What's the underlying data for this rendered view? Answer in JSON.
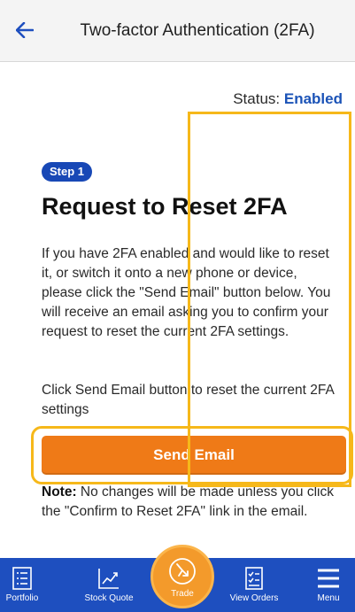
{
  "header": {
    "back_icon": "arrow-left-icon",
    "title": "Two-factor Authentication (2FA)"
  },
  "status": {
    "label": "Status:",
    "value": "Enabled"
  },
  "step": {
    "badge": "Step 1",
    "heading": "Request to Reset 2FA",
    "paragraph1": "If you have 2FA enabled and would like to reset it, or switch it onto a new phone or device, please click the \"Send Email\" button below. You will receive an email asking you to confirm your request to reset the current 2FA settings.",
    "paragraph2": "Click Send Email button to reset the current 2FA settings",
    "send_button": "Send Email",
    "note_label": "Note:",
    "note_text": "No changes will be made unless you click the \"Confirm to Reset 2FA\" link in the email."
  },
  "tabbar": {
    "items": [
      {
        "label": "Portfolio",
        "icon": "list-icon"
      },
      {
        "label": "Stock Quote",
        "icon": "chart-icon"
      },
      {
        "label": "Trade",
        "icon": "trade-icon"
      },
      {
        "label": "View Orders",
        "icon": "checklist-icon"
      },
      {
        "label": "Menu",
        "icon": "hamburger-icon"
      }
    ]
  },
  "colors": {
    "brand_blue": "#1e4fbf",
    "accent_orange": "#ef7a17",
    "highlight_yellow": "#f6b81a",
    "status_blue": "#1b53b7"
  }
}
